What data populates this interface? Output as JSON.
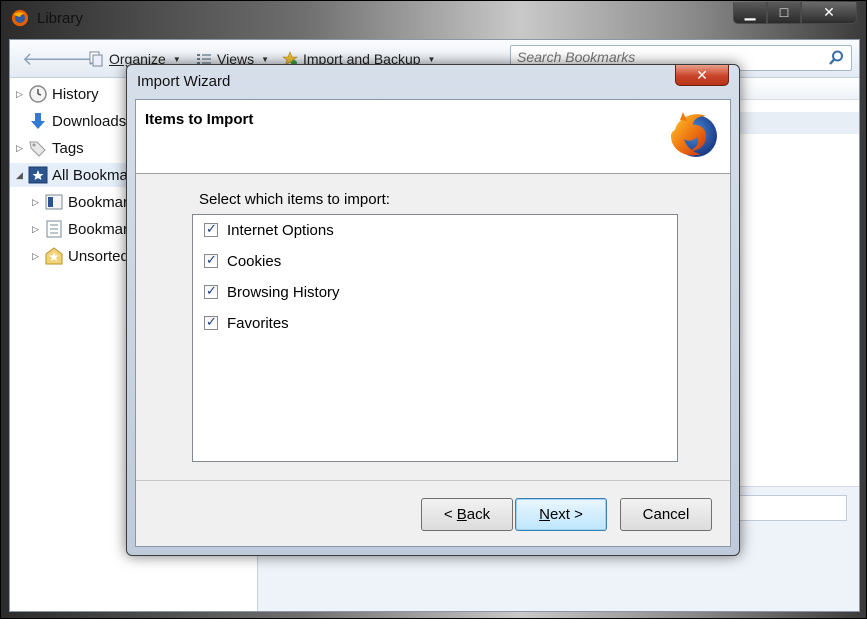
{
  "library": {
    "title": "Library",
    "toolbar": {
      "organize_label": "Organize",
      "views_label": "Views",
      "import_label": "Import and Backup",
      "search_placeholder": "Search Bookmarks"
    },
    "sidebar": {
      "items": [
        {
          "label": "History",
          "icon": "clock-icon"
        },
        {
          "label": "Downloads",
          "icon": "download-arrow-icon"
        },
        {
          "label": "Tags",
          "icon": "tag-icon"
        },
        {
          "label": "All Bookma",
          "icon": "star-folder-icon"
        },
        {
          "label": "Bookmar",
          "icon": "bookmarks-toolbar-icon"
        },
        {
          "label": "Bookmar",
          "icon": "bookmarks-menu-icon"
        },
        {
          "label": "Unsorted",
          "icon": "unsorted-bookmarks-icon"
        }
      ]
    }
  },
  "wizard": {
    "title": "Import Wizard",
    "close_label": "✕",
    "heading": "Items to Import",
    "prompt": "Select which items to import:",
    "items": [
      {
        "label": "Internet Options",
        "checked": true
      },
      {
        "label": "Cookies",
        "checked": true
      },
      {
        "label": "Browsing History",
        "checked": true
      },
      {
        "label": "Favorites",
        "checked": true
      }
    ],
    "buttons": {
      "back_prefix": "< ",
      "back_key": "B",
      "back_rest": "ack",
      "next_key": "N",
      "next_rest": "ext >",
      "cancel": "Cancel"
    }
  },
  "colors": {
    "accent": "#3c7fb1",
    "close_red": "#c8452a",
    "checkmark": "#1b3c8a"
  }
}
